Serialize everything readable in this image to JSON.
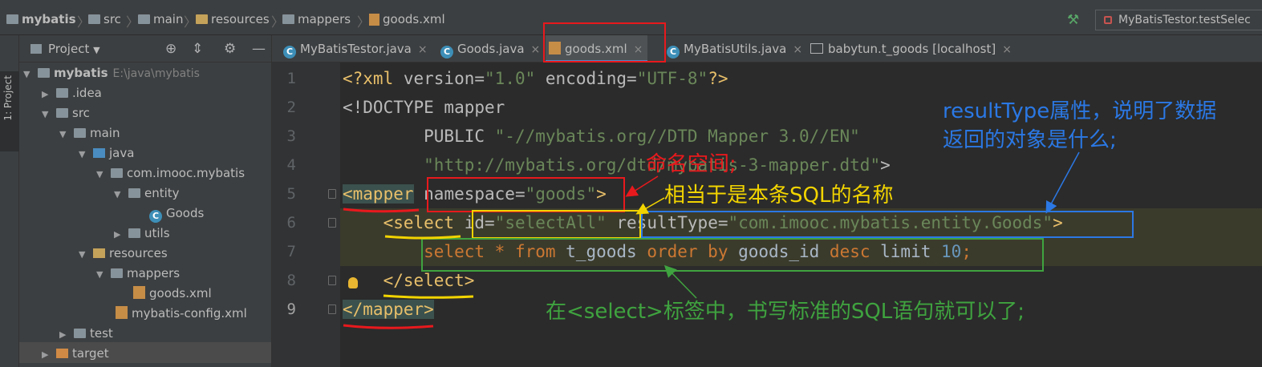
{
  "breadcrumb": {
    "items": [
      "mybatis",
      "src",
      "main",
      "resources",
      "mappers",
      "goods.xml"
    ]
  },
  "run_config": {
    "label": "MyBatisTestor.testSelec"
  },
  "tool_window": {
    "stripe_label": "1: Project",
    "title": "Project"
  },
  "tree": {
    "items": [
      {
        "label": "mybatis",
        "path": "E:\\java\\mybatis"
      },
      {
        "label": ".idea"
      },
      {
        "label": "src"
      },
      {
        "label": "main"
      },
      {
        "label": "java"
      },
      {
        "label": "com.imooc.mybatis"
      },
      {
        "label": "entity"
      },
      {
        "label": "Goods"
      },
      {
        "label": "utils"
      },
      {
        "label": "resources"
      },
      {
        "label": "mappers"
      },
      {
        "label": "goods.xml"
      },
      {
        "label": "mybatis-config.xml"
      },
      {
        "label": "test"
      },
      {
        "label": "target"
      }
    ]
  },
  "tabs": [
    {
      "label": "MyBatisTestor.java"
    },
    {
      "label": "Goods.java"
    },
    {
      "label": "goods.xml"
    },
    {
      "label": "MyBatisUtils.java"
    },
    {
      "label": "babytun.t_goods [localhost]"
    }
  ],
  "line_numbers": [
    "1",
    "2",
    "3",
    "4",
    "5",
    "6",
    "7",
    "8",
    "9"
  ],
  "code": {
    "l1": {
      "a": "<?xml ",
      "b": "version",
      "c": "=",
      "d": "\"1.0\"",
      "e": " encoding",
      "f": "=",
      "g": "\"UTF-8\"",
      "h": "?>"
    },
    "l2": {
      "a": "<!DOCTYPE mapper"
    },
    "l3": {
      "a": "        PUBLIC ",
      "b": "\"-//mybatis.org//DTD Mapper 3.0//EN\""
    },
    "l4": {
      "a": "        ",
      "b": "\"http://mybatis.org/dtd/mybatis-3-mapper.dtd\"",
      "c": ">"
    },
    "l5": {
      "a": "<mapper",
      "b": " namespace",
      "c": "=",
      "d": "\"goods\"",
      "e": ">"
    },
    "l6": {
      "a": "    ",
      "b": "<select",
      "c": " id",
      "d": "=",
      "e": "\"selectAll\"",
      "f": " resultType",
      "g": "=",
      "h": "\"com.imooc.mybatis.entity.Goods\"",
      "i": ">"
    },
    "l7": {
      "a": "        ",
      "b": "select",
      "c": " * ",
      "d": "from",
      "e": " t_goods ",
      "f": "order by",
      "g": " goods_id ",
      "h": "desc",
      "i": " limit ",
      "j": "10",
      "k": ";"
    },
    "l8": {
      "a": "    ",
      "b": "</select>"
    },
    "l9": {
      "a": "</mapper>"
    }
  },
  "annotations": {
    "namespace": "命名空间;",
    "sql_name": "相当于是本条SQL的名称",
    "result_type_1": "resultType属性，说明了数据",
    "result_type_2": "返回的对象是什么;",
    "select_tag": "在<select>标签中，书写标准的SQL语句就可以了;"
  },
  "colors": {
    "red": "#e8191d",
    "yellow": "#f2d400",
    "blue": "#2b78e4",
    "green": "#3fa33f"
  }
}
